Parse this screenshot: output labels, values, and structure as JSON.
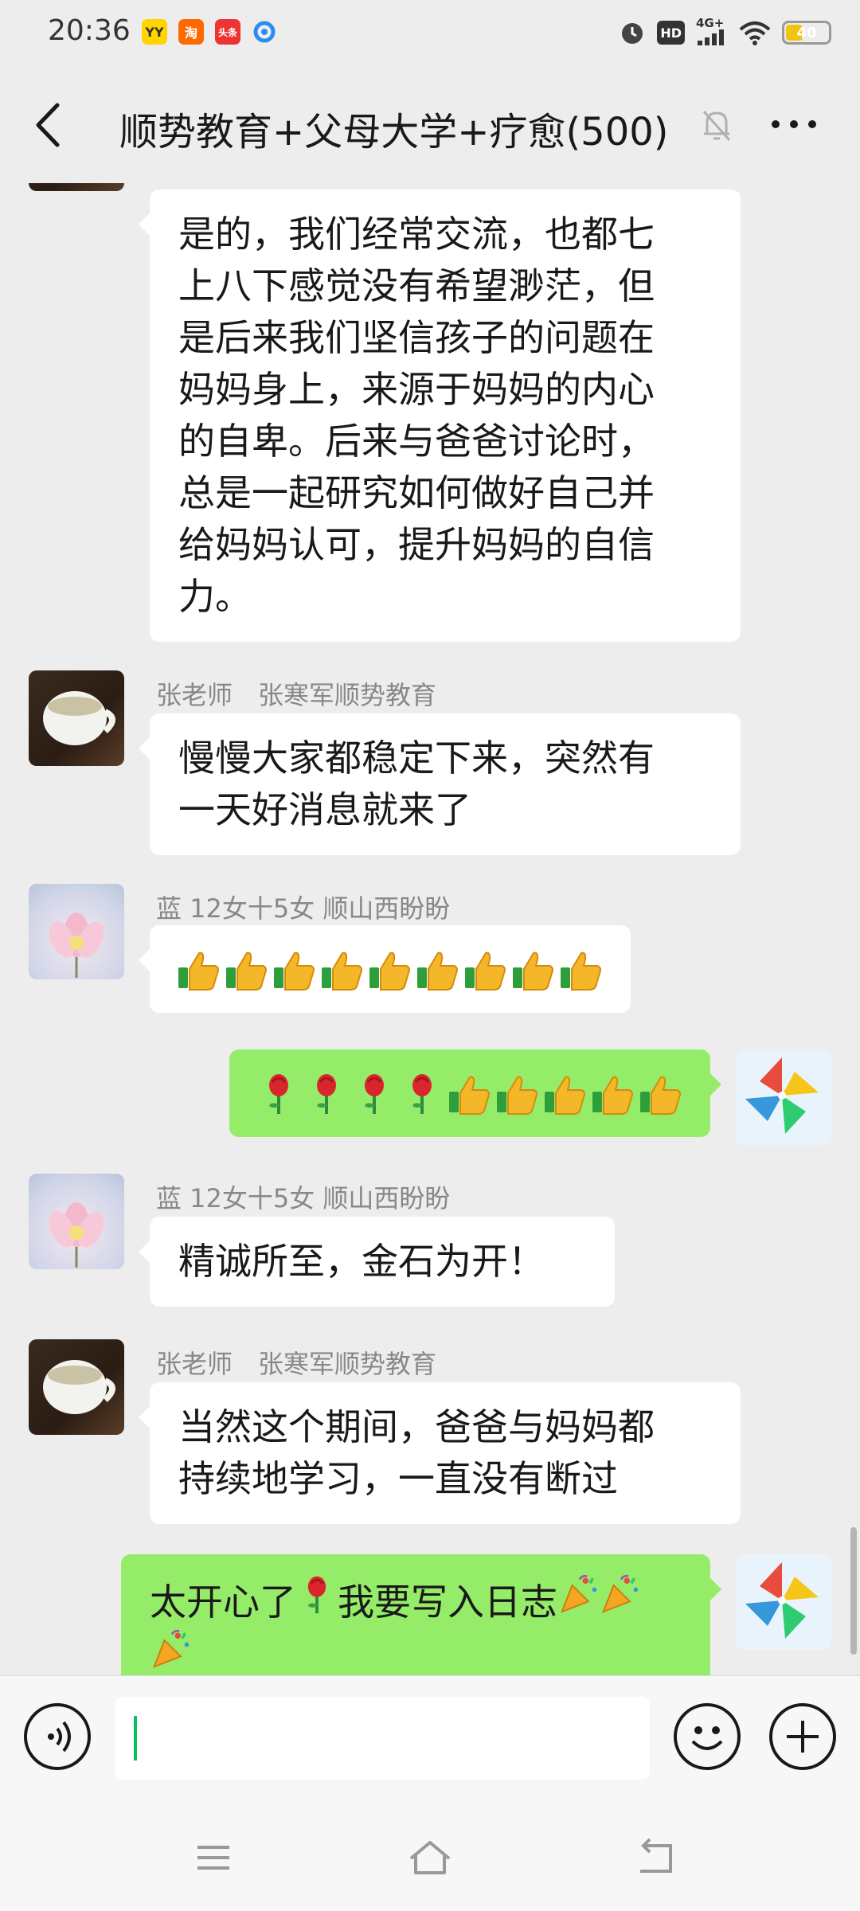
{
  "status_bar": {
    "time": "20:36",
    "apps": [
      "YY",
      "淘",
      "头条",
      ""
    ],
    "hd_badge": "HD",
    "network": "4G+",
    "battery": "40",
    "battery_level": 0.4
  },
  "header": {
    "title": "顺势教育+父母大学+疗愈(500)"
  },
  "messages": [
    {
      "direction": "in",
      "avatar": "cup",
      "sender": "",
      "lines": [
        "是的，我们经常交流，也都七",
        "上八下感觉没有希望渺茫，但",
        "是后来我们坚信孩子的问题在",
        "妈妈身上，来源于妈妈的内心",
        "的自卑。后来与爸爸讨论时，",
        "总是一起研究如何做好自己并",
        "给妈妈认可，提升妈妈的自信",
        "力。"
      ]
    },
    {
      "direction": "in",
      "avatar": "cup",
      "sender": "张老师　张寒军顺势教育",
      "lines": [
        "慢慢大家都稳定下来，突然有",
        "一天好消息就来了"
      ]
    },
    {
      "direction": "in",
      "avatar": "lotus",
      "sender": "蓝  12女十5女  顺山西盼盼",
      "emojis": [
        "thumbs-up",
        "thumbs-up",
        "thumbs-up",
        "thumbs-up",
        "thumbs-up",
        "thumbs-up",
        "thumbs-up",
        "thumbs-up",
        "thumbs-up"
      ]
    },
    {
      "direction": "out",
      "avatar": "pinwheel",
      "emojis": [
        "rose",
        "rose",
        "rose",
        "rose",
        "thumbs-up",
        "thumbs-up",
        "thumbs-up",
        "thumbs-up",
        "thumbs-up"
      ]
    },
    {
      "direction": "in",
      "avatar": "lotus",
      "sender": "蓝  12女十5女  顺山西盼盼",
      "lines": [
        "精诚所至，金石为开！"
      ]
    },
    {
      "direction": "in",
      "avatar": "cup",
      "sender": "张老师　张寒军顺势教育",
      "lines": [
        "当然这个期间，爸爸与妈妈都",
        "持续地学习，一直没有断过"
      ]
    },
    {
      "direction": "out",
      "avatar": "pinwheel",
      "text_before": "太开心了",
      "text_after": "我要写入日志",
      "emojis": [
        "rose",
        "party-popper",
        "party-popper",
        "party-popper"
      ]
    }
  ],
  "input_bar": {
    "text": "",
    "icons": [
      "voice-icon",
      "emoji-icon",
      "plus-icon"
    ]
  },
  "nav_bar": {
    "icons": [
      "menu-icon",
      "home-icon",
      "back-nav-icon"
    ]
  },
  "colors": {
    "background": "#ededed",
    "incoming_bubble": "#ffffff",
    "outgoing_bubble": "#95ec69",
    "accent": "#07c160"
  }
}
